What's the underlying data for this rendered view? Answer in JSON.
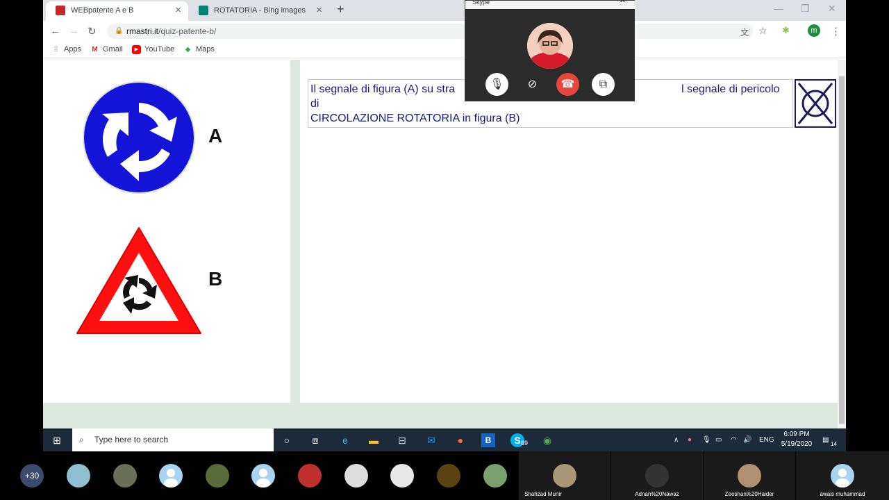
{
  "browser": {
    "tabs": [
      {
        "title": "WEBpatente A e B",
        "favicon_color": "#c62828"
      },
      {
        "title": "ROTATORIA - Bing images",
        "favicon_color": "#008373"
      }
    ],
    "url": {
      "domain": "rmastri.it",
      "path": "/quiz-patente-b/"
    },
    "bookmarks": [
      "Apps",
      "Gmail",
      "YouTube",
      "Maps"
    ],
    "profile_initial": "m"
  },
  "page": {
    "sign_a_label": "A",
    "sign_b_label": "B",
    "question_visible_1": "Il segnale di figura (A) su stra",
    "question_visible_2": "l segnale di pericolo di",
    "question_line_2": "CIRCOLAZIONE ROTATORIA in figura (B)"
  },
  "skype": {
    "title": "Skype",
    "controls": [
      "microphone-icon",
      "video-off-icon",
      "end-call-icon",
      "window-icon"
    ]
  },
  "taskbar": {
    "search_placeholder": "Type here to search",
    "skype_badge": "89",
    "lang": "ENG",
    "time": "6:09 PM",
    "date": "5/19/2020",
    "notif_count": "14"
  },
  "meeting": {
    "more_count": "+30",
    "named_participants": [
      "Shahzad Munir",
      "Adnan%20Nawaz",
      "Zeeshan%20Haider",
      "awais muhammad"
    ]
  },
  "colors": {
    "sign_blue": "#1414d8",
    "sign_red": "#ff1010",
    "end_call": "#e8453c"
  }
}
